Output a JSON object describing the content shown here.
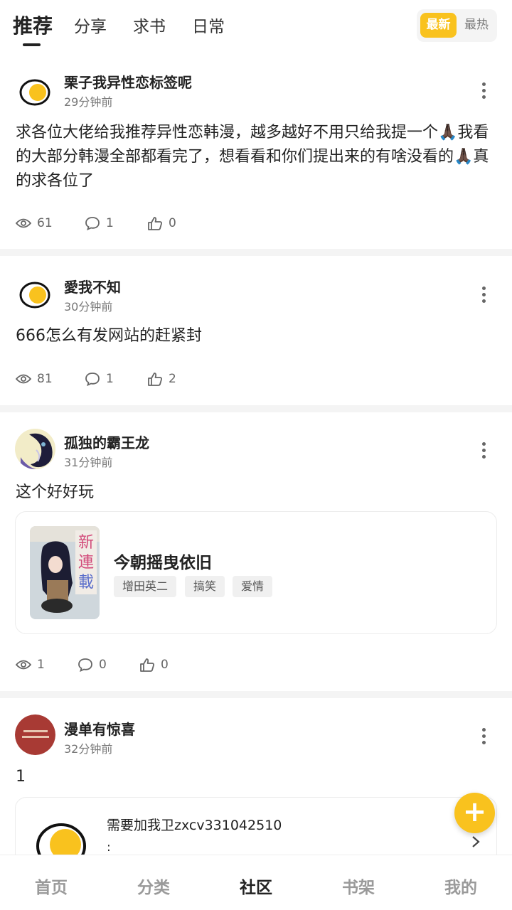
{
  "top_tabs": [
    {
      "label": "推荐"
    },
    {
      "label": "分享"
    },
    {
      "label": "求书"
    },
    {
      "label": "日常"
    }
  ],
  "sort": {
    "newest": "最新",
    "hottest": "最热"
  },
  "posts": [
    {
      "author": "栗子我异性恋标签呢",
      "time": "29分钟前",
      "content": "求各位大佬给我推荐异性恋韩漫，越多越好不用只给我提一个🙏🏿我看的大部分韩漫全部都看完了，想看看和你们提出来的有啥没看的🙏🏿真的求各位了",
      "views": "61",
      "comments": "1",
      "likes": "0"
    },
    {
      "author": "愛我不知",
      "time": "30分钟前",
      "content": "666怎么有发网站的赶紧封",
      "views": "81",
      "comments": "1",
      "likes": "2"
    },
    {
      "author": "孤独的霸王龙",
      "time": "31分钟前",
      "content": "这个好好玩",
      "views": "1",
      "comments": "0",
      "likes": "0",
      "book": {
        "title": "今朝摇曳依旧",
        "tags": [
          "增田英二",
          "搞笑",
          "爱情"
        ],
        "cover_text": "新連載"
      }
    },
    {
      "author": "漫单有惊喜",
      "time": "32分钟前",
      "content": "1",
      "link": {
        "text": "需要加我卫zxcv331042510",
        "sub": ":"
      }
    }
  ],
  "bottom_nav": [
    {
      "label": "首页"
    },
    {
      "label": "分类"
    },
    {
      "label": "社区"
    },
    {
      "label": "书架"
    },
    {
      "label": "我的"
    }
  ],
  "colors": {
    "accent": "#f9c21e",
    "muted": "#777777"
  }
}
